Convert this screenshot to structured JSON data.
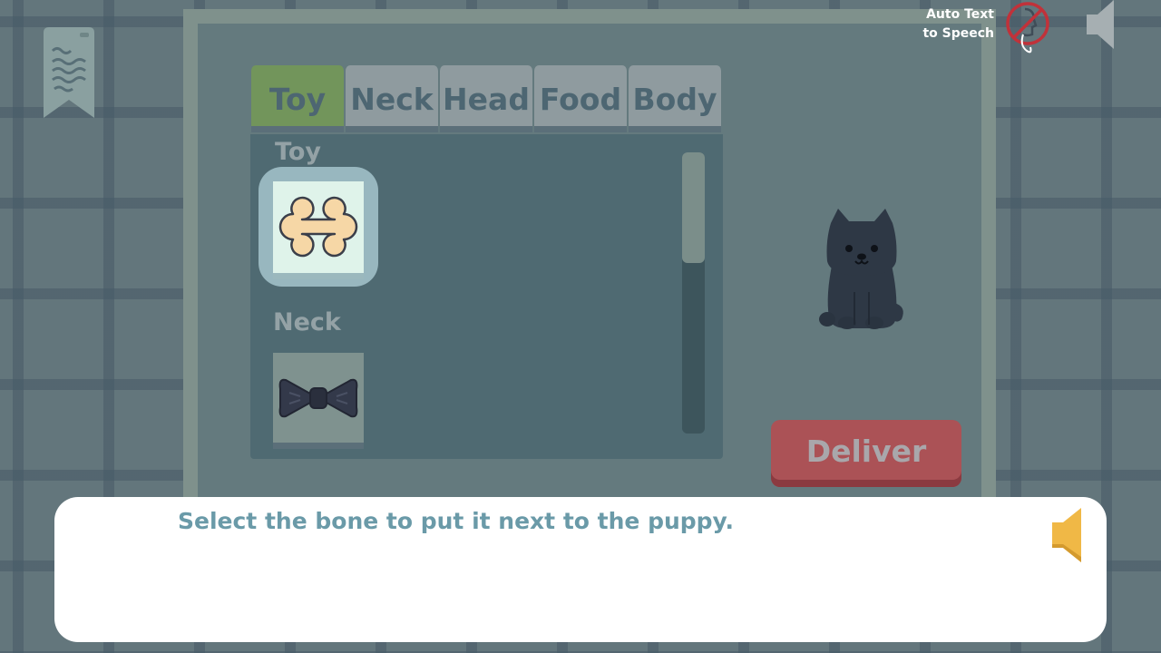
{
  "tabs": [
    {
      "label": "Toy",
      "active": true
    },
    {
      "label": "Neck",
      "active": false
    },
    {
      "label": "Head",
      "active": false
    },
    {
      "label": "Food",
      "active": false
    },
    {
      "label": "Body",
      "active": false
    }
  ],
  "inventory": {
    "sections": [
      {
        "label": "Toy",
        "items": [
          {
            "icon": "bone-icon",
            "selected": true
          }
        ]
      },
      {
        "label": "Neck",
        "items": [
          {
            "icon": "bow-tie-icon",
            "selected": false
          }
        ]
      }
    ]
  },
  "deliver_label": "Deliver",
  "tts": {
    "label_line1": "Auto Text",
    "label_line2": "to Speech",
    "enabled": false
  },
  "dialog": {
    "text": "Select the bone to put it next to the puppy."
  },
  "colors": {
    "active_tab": "#72955b",
    "deliver": "#ab5256",
    "dialog_text": "#6a9aa8",
    "speaker": "#f0b846"
  }
}
